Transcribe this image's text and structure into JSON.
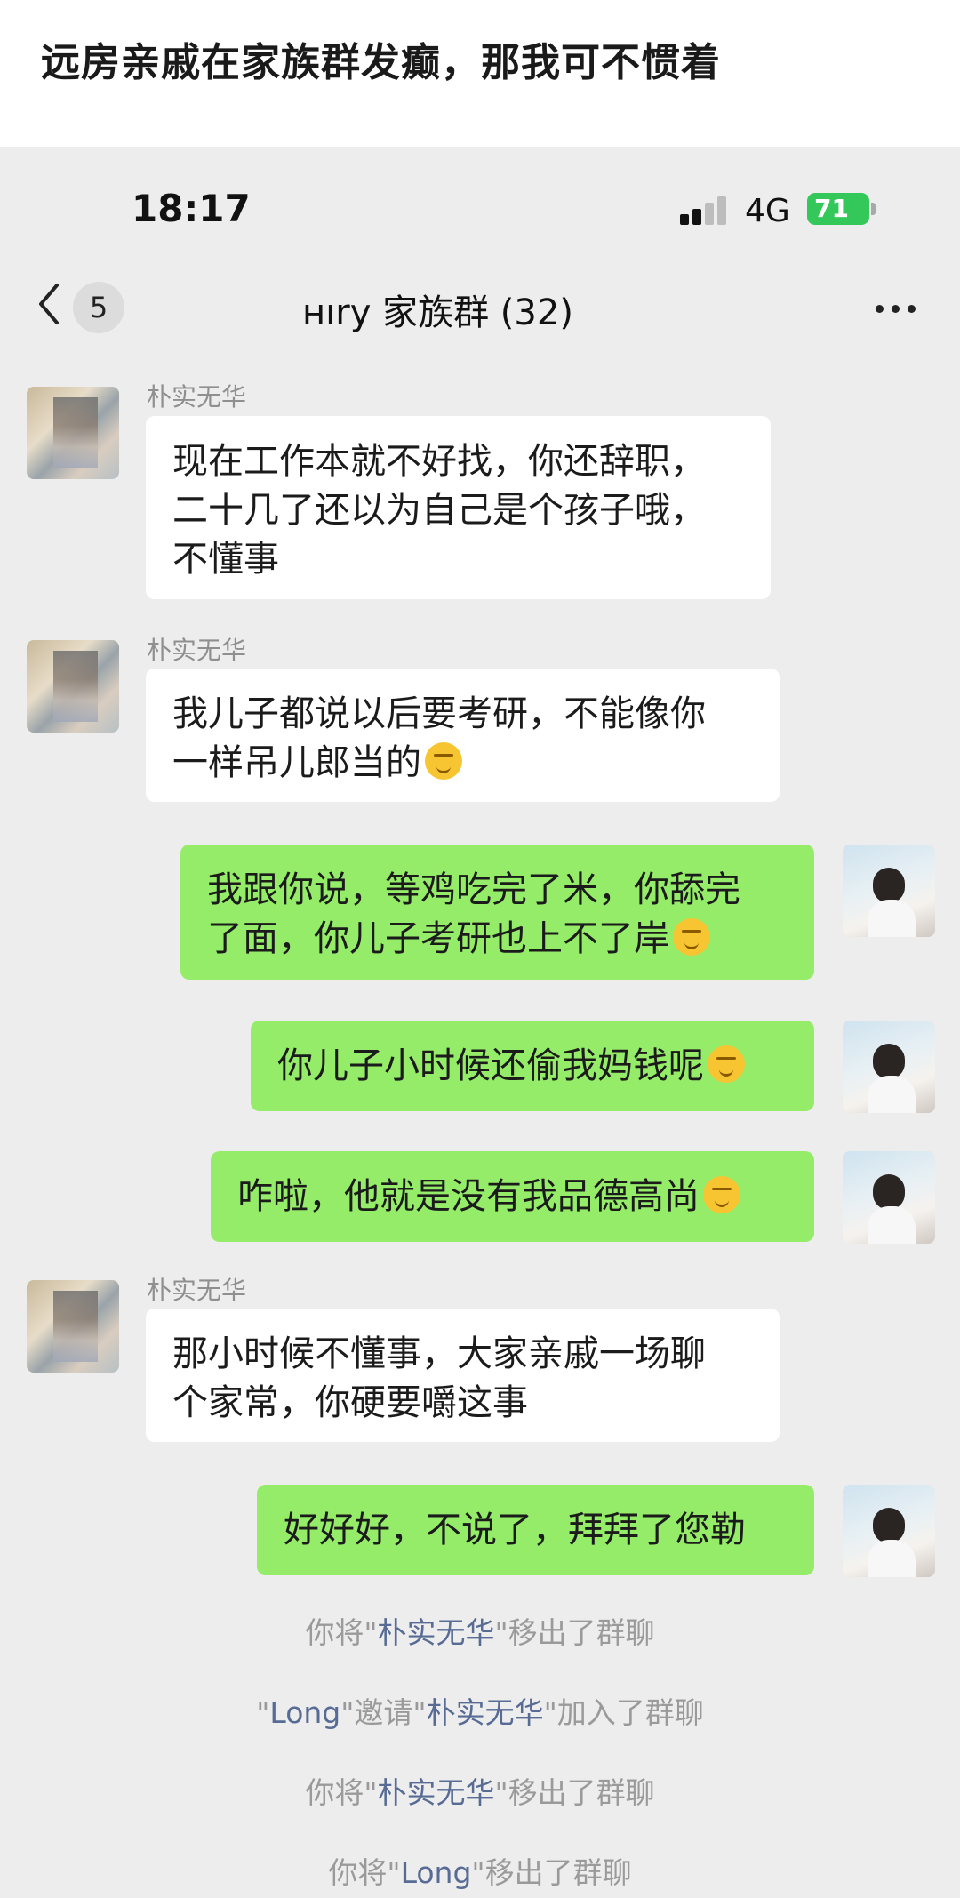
{
  "post": {
    "title": "远房亲戚在家族群发癫，那我可不惯着"
  },
  "status_bar": {
    "time": "18:17",
    "network": "4G",
    "battery": "71"
  },
  "nav": {
    "back_count": "5",
    "group_title": "ʜıry 家族群 (32)"
  },
  "messages": [
    {
      "sender": "朴实无华",
      "lines": [
        "现在工作本就不好找，你还辞职，",
        "二十几了还以为自己是个孩子哦，",
        "不懂事"
      ]
    },
    {
      "sender": "朴实无华",
      "lines": [
        "我儿子都说以后要考研，不能像你",
        "一样吊儿郎当的"
      ]
    },
    {
      "lines": [
        "我跟你说，等鸡吃完了米，你舔完",
        "了面，你儿子考研也上不了岸"
      ]
    },
    {
      "lines": [
        "你儿子小时候还偷我妈钱呢"
      ]
    },
    {
      "lines": [
        "咋啦，他就是没有我品德高尚"
      ]
    },
    {
      "sender": "朴实无华",
      "lines": [
        "那小时候不懂事，大家亲戚一场聊",
        "个家常，你硬要嚼这事"
      ]
    },
    {
      "lines": [
        "好好好，不说了，拜拜了您勒"
      ]
    }
  ],
  "system": {
    "line1": {
      "a": "你将\"",
      "name": "朴实无华",
      "b": "\"移出了群聊"
    },
    "line2": {
      "q1": "\"",
      "inviter": "Long",
      "mid": "\"邀请\"",
      "name": "朴实无华",
      "b": "\"加入了群聊"
    },
    "line3": {
      "a": "你将\"",
      "name": "朴实无华",
      "b": "\"移出了群聊"
    },
    "line4": {
      "a": "你将\"",
      "name": "Long",
      "b": "\"移出了群聊"
    }
  },
  "icons": {
    "back": "chevron-left-icon",
    "more": "more-dots-icon",
    "emoji": "thinking-face-icon"
  },
  "colors": {
    "out_bubble": "#95ec69",
    "in_bubble": "#ffffff",
    "battery": "#34c759",
    "name_link": "#576b95"
  }
}
